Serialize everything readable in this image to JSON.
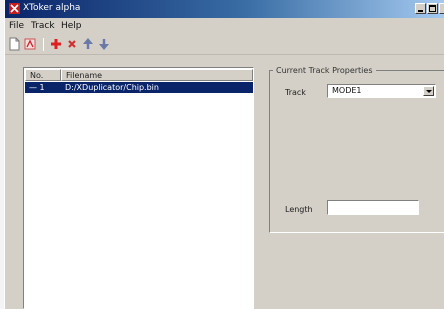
{
  "window": {
    "title": "XToker alpha",
    "icons": [
      "app-icon",
      "minimize-icon",
      "maximize-icon",
      "close-icon"
    ]
  },
  "menu": [
    {
      "label": "File"
    },
    {
      "label": "Track"
    },
    {
      "label": "Help"
    }
  ],
  "toolbar": {
    "icons": [
      "new-icon",
      "open-icon",
      "add-icon",
      "remove-icon",
      "move-up-icon",
      "move-down-icon"
    ]
  },
  "file_list": {
    "columns": [
      "No.",
      "Filename"
    ],
    "rows": [
      {
        "no": "— 1",
        "filename": "D:/XDuplicator/Chip.bin",
        "selected": true
      }
    ]
  },
  "properties": {
    "group_label": "Current Track Properties",
    "track_label": "Track",
    "track_value": "MODE1",
    "length_label": "Length",
    "length_value": ""
  },
  "colors": {
    "title_bar": "#0a246a",
    "selection": "#0a246a",
    "face": "#d4d0c8",
    "add_icon": "#e02020",
    "remove_icon": "#d03030"
  }
}
